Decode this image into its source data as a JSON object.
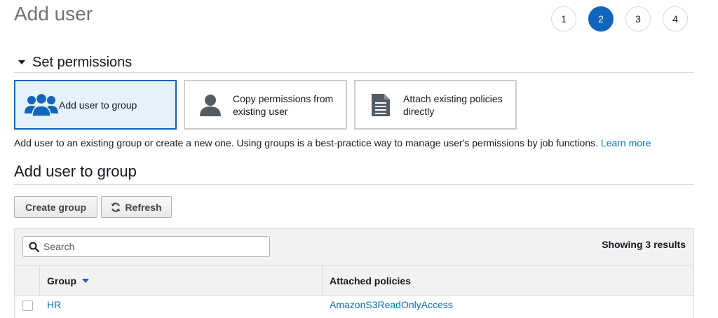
{
  "page": {
    "title": "Add user"
  },
  "steps": [
    "1",
    "2",
    "3",
    "4"
  ],
  "active_step": "2",
  "section": {
    "title": "Set permissions"
  },
  "options": [
    {
      "label": "Add user to group",
      "icon": "user-group-icon",
      "selected": true
    },
    {
      "label": "Copy permissions from existing user",
      "icon": "user-icon",
      "selected": false
    },
    {
      "label": "Attach existing policies directly",
      "icon": "document-icon",
      "selected": false
    }
  ],
  "help": {
    "text": "Add user to an existing group or create a new one. Using groups is a best-practice way to manage user's permissions by job functions.",
    "link": "Learn more"
  },
  "group_section": {
    "title": "Add user to group"
  },
  "buttons": {
    "create_group": "Create group",
    "refresh": "Refresh"
  },
  "table": {
    "search_placeholder": "Search",
    "results": "Showing 3 results",
    "columns": [
      "Group",
      "Attached policies"
    ],
    "rows": [
      {
        "group": "HR",
        "policy": "AmazonS3ReadOnlyAccess"
      }
    ]
  },
  "colors": {
    "accent": "#1166bb",
    "link": "#0073bb",
    "selected_bg": "#e6f2fb"
  }
}
